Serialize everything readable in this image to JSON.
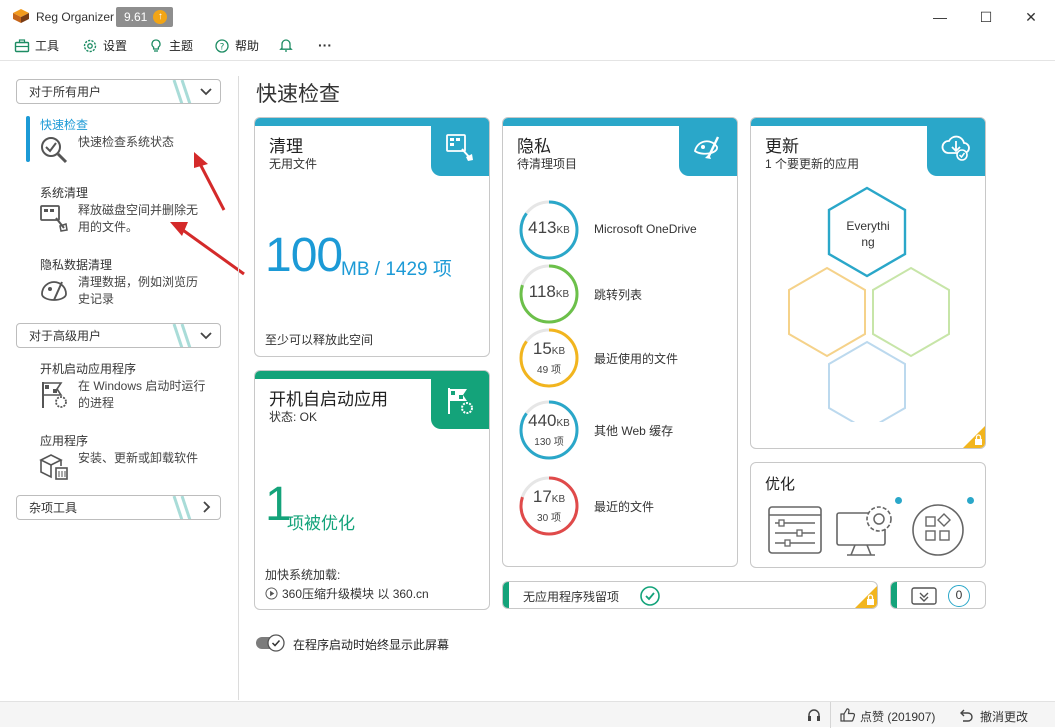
{
  "window": {
    "title": "Reg Organizer",
    "version": "9.61",
    "update_glyph": "↑",
    "minimize_glyph": "—",
    "maximize_glyph": "☐",
    "close_glyph": "✕"
  },
  "menu": {
    "tools": "工具",
    "settings": "设置",
    "theme": "主题",
    "help": "帮助",
    "more": "···"
  },
  "sidebar": {
    "group_all_users": "对于所有用户",
    "group_advanced": "对于高级用户",
    "group_misc": "杂项工具",
    "items": [
      {
        "title": "快速检查",
        "desc": "快速检查系统状态",
        "icon": "magnifier-check-icon"
      },
      {
        "title": "系统清理",
        "desc": "释放磁盘空间并删除无用的文件。",
        "icon": "broom-cleanup-icon"
      },
      {
        "title": "隐私数据清理",
        "desc": "清理数据，例如浏览历史记录",
        "icon": "privacy-brush-icon"
      },
      {
        "title": "开机启动应用程序",
        "desc": "在 Windows 启动时运行的进程",
        "icon": "startup-flag-icon"
      },
      {
        "title": "应用程序",
        "desc": "安装、更新或卸载软件",
        "icon": "app-box-icon"
      }
    ]
  },
  "main": {
    "title": "快速检查",
    "cleanup": {
      "title": "清理",
      "subtitle": "无用文件",
      "value": "100",
      "unit": "MB / 1429 项",
      "footer": "至少可以释放此空间"
    },
    "startup": {
      "title": "开机自启动应用",
      "subtitle": "状态: OK",
      "value": "1",
      "unit": "项被优化",
      "footer1": "加快系统加载:",
      "footer2": "360压缩升级模块 以 360.cn"
    },
    "privacy": {
      "title": "隐私",
      "subtitle": "待清理项目",
      "rows": [
        {
          "value": "413",
          "unit": "KB",
          "sub": "",
          "label": "Microsoft OneDrive",
          "color": "#2aa7c9",
          "fill": 0.85
        },
        {
          "value": "118",
          "unit": "KB",
          "sub": "",
          "label": "跳转列表",
          "color": "#6cc04a",
          "fill": 0.8
        },
        {
          "value": "15",
          "unit": "KB",
          "sub": "49 项",
          "label": "最近使用的文件",
          "color": "#f2b51e",
          "fill": 0.85
        },
        {
          "value": "440",
          "unit": "KB",
          "sub": "130 项",
          "label": "其他 Web 缓存",
          "color": "#2aa7c9",
          "fill": 0.85
        },
        {
          "value": "17",
          "unit": "KB",
          "sub": "30 项",
          "label": "最近的文件",
          "color": "#e04a4a",
          "fill": 0.8
        }
      ]
    },
    "update": {
      "title": "更新",
      "subtitle": "1 个要更新的应用",
      "app_label": "Everything"
    },
    "optimize": {
      "title": "优化"
    },
    "leftover": {
      "label": "无应用程序残留项"
    },
    "trash": {
      "count": "0"
    },
    "toggle_label": "在程序启动时始终显示此屏幕"
  },
  "status": {
    "like_text": "点赞 (201907)",
    "undo_text": "撤消更改"
  },
  "colors": {
    "accent_blue": "#1c9ad6",
    "card_blue": "#2aa7c9",
    "card_green": "#14a37a",
    "lock_yellow": "#f2b51e"
  }
}
